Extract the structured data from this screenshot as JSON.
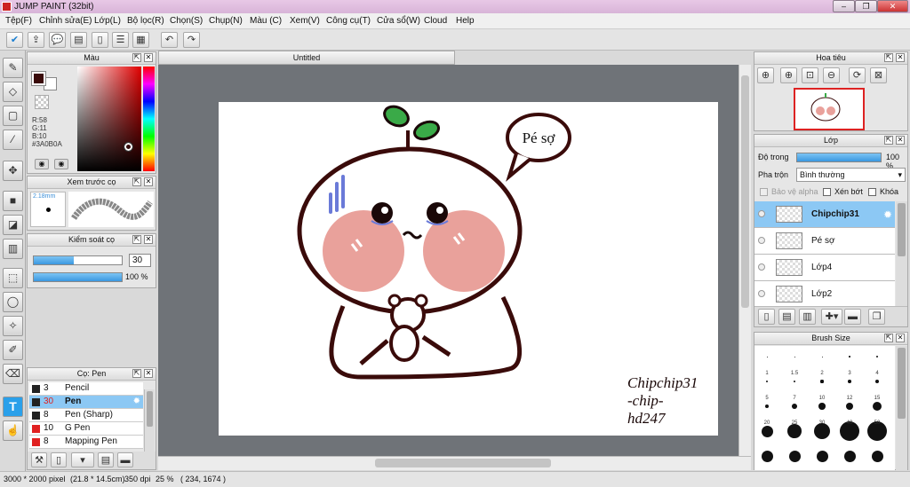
{
  "app": {
    "title": "JUMP PAINT (32bit)"
  },
  "menu": [
    "Tệp(F)",
    "Chỉnh sửa(E)",
    "Lớp(L)",
    "Bộ lọc(R)",
    "Chọn(S)",
    "Chụp(N)",
    "Màu (C)",
    "Xem(V)",
    "Công cụ(T)",
    "Cửa sổ(W)",
    "Cloud",
    "Help"
  ],
  "color_panel": {
    "title": "Màu",
    "r": "R:58",
    "g": "G:11",
    "b": "B:10",
    "hex": "#3A0B0A",
    "fg": "#3a0b0a",
    "bg": "#ffffff"
  },
  "preview_panel": {
    "title": "Xem trước cọ",
    "size": "2.18mm"
  },
  "control_panel": {
    "title": "Kiểm soát cọ",
    "size_value": "30",
    "opacity_value": "100 %",
    "size_fill": 0.45,
    "opacity_fill": 1.0
  },
  "brush_panel": {
    "title": "Cọ: Pen",
    "items": [
      {
        "color": "#222222",
        "size": "3",
        "name": "Pencil"
      },
      {
        "color": "#222222",
        "size": "30",
        "name": "Pen",
        "selected": true
      },
      {
        "color": "#222222",
        "size": "8",
        "name": "Pen (Sharp)"
      },
      {
        "color": "#e02020",
        "size": "10",
        "name": "G Pen"
      },
      {
        "color": "#e02020",
        "size": "8",
        "name": "Mapping Pen"
      }
    ]
  },
  "document": {
    "tab": "Untitled"
  },
  "artwork": {
    "bubble_text": "Pé sợ",
    "signature_1": "Chipchip31",
    "signature_2": "-chip-",
    "signature_3": "hd247"
  },
  "navigator": {
    "title": "Hoa tiêu"
  },
  "layer_panel": {
    "title": "Lớp",
    "opacity_label": "Độ trong",
    "opacity_value": "100 %",
    "blend_label": "Pha trộn",
    "blend_value": "Bình thường",
    "protect_alpha": "Bảo vệ alpha",
    "clipping": "Xén bớt",
    "lock": "Khóa",
    "layers": [
      {
        "name": "Chipchip31",
        "selected": true
      },
      {
        "name": "Pé sợ"
      },
      {
        "name": "Lớp4"
      },
      {
        "name": "Lớp2"
      }
    ]
  },
  "brush_size_panel": {
    "title": "Brush Size",
    "labels": [
      "1",
      "1.5",
      "2",
      "3",
      "4",
      "5",
      "7",
      "10",
      "12",
      "15",
      "20",
      "25",
      "30",
      "40",
      "50"
    ]
  },
  "status": {
    "dims": "3000 * 2000 pixel",
    "cm": "(21.8 * 14.5cm)",
    "dpi": "350 dpi",
    "zoom": "25 %",
    "coords": "( 234, 1674 )"
  }
}
